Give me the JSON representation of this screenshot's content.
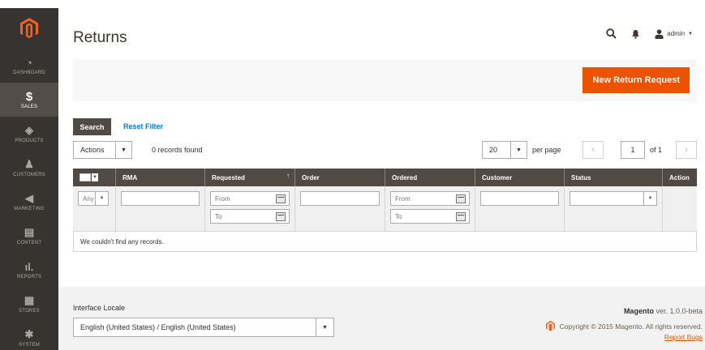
{
  "sidebar": {
    "items": [
      {
        "label": "Dashboard",
        "icon": "dashboard-icon",
        "glyph": "◔"
      },
      {
        "label": "Sales",
        "icon": "dollar-icon",
        "glyph": "$"
      },
      {
        "label": "Products",
        "icon": "cube-icon",
        "glyph": "◈"
      },
      {
        "label": "Customers",
        "icon": "person-icon",
        "glyph": "♟"
      },
      {
        "label": "Marketing",
        "icon": "megaphone-icon",
        "glyph": "◀"
      },
      {
        "label": "Content",
        "icon": "content-icon",
        "glyph": "▤"
      },
      {
        "label": "Reports",
        "icon": "bar-chart-icon",
        "glyph": "ıl."
      },
      {
        "label": "Stores",
        "icon": "store-icon",
        "glyph": "▦"
      },
      {
        "label": "System",
        "icon": "gear-icon",
        "glyph": "✱"
      }
    ]
  },
  "header": {
    "title": "Returns",
    "user": "admin"
  },
  "actions": {
    "new_request": "New Return Request"
  },
  "grid_controls": {
    "search": "Search",
    "reset_filter": "Reset Filter",
    "actions": "Actions",
    "records_found": "0 records found",
    "per_page_value": "20",
    "per_page_label": "per page",
    "page": "1",
    "of_pages": "of 1"
  },
  "grid": {
    "columns": [
      "RMA",
      "Requested",
      "Order",
      "Ordered",
      "Customer",
      "Status",
      "Action"
    ],
    "filters": {
      "any": "Any",
      "from": "From",
      "to": "To"
    },
    "empty_text": "We couldn't find any records."
  },
  "footer": {
    "locale_label": "Interface Locale",
    "locale_value": "English (United States) / English (United States)",
    "brand": "Magento",
    "version": "ver. 1.0.0-beta",
    "copyright": "Copyright © 2015 Magento. All rights reserved.",
    "report_bugs": "Report Bugs"
  },
  "colors": {
    "sidebar_bg": "#373330",
    "accent": "#eb5202",
    "grid_header": "#514943",
    "link": "#007bdb"
  }
}
